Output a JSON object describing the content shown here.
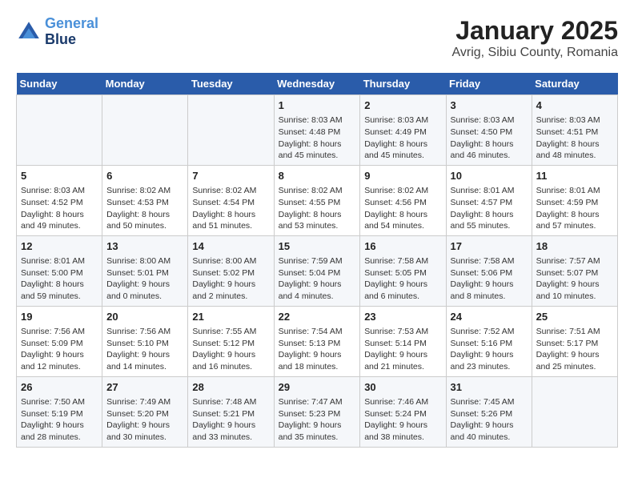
{
  "logo": {
    "line1": "General",
    "line2": "Blue"
  },
  "title": "January 2025",
  "subtitle": "Avrig, Sibiu County, Romania",
  "days_of_week": [
    "Sunday",
    "Monday",
    "Tuesday",
    "Wednesday",
    "Thursday",
    "Friday",
    "Saturday"
  ],
  "weeks": [
    [
      {
        "day": "",
        "info": ""
      },
      {
        "day": "",
        "info": ""
      },
      {
        "day": "",
        "info": ""
      },
      {
        "day": "1",
        "info": "Sunrise: 8:03 AM\nSunset: 4:48 PM\nDaylight: 8 hours\nand 45 minutes."
      },
      {
        "day": "2",
        "info": "Sunrise: 8:03 AM\nSunset: 4:49 PM\nDaylight: 8 hours\nand 45 minutes."
      },
      {
        "day": "3",
        "info": "Sunrise: 8:03 AM\nSunset: 4:50 PM\nDaylight: 8 hours\nand 46 minutes."
      },
      {
        "day": "4",
        "info": "Sunrise: 8:03 AM\nSunset: 4:51 PM\nDaylight: 8 hours\nand 48 minutes."
      }
    ],
    [
      {
        "day": "5",
        "info": "Sunrise: 8:03 AM\nSunset: 4:52 PM\nDaylight: 8 hours\nand 49 minutes."
      },
      {
        "day": "6",
        "info": "Sunrise: 8:02 AM\nSunset: 4:53 PM\nDaylight: 8 hours\nand 50 minutes."
      },
      {
        "day": "7",
        "info": "Sunrise: 8:02 AM\nSunset: 4:54 PM\nDaylight: 8 hours\nand 51 minutes."
      },
      {
        "day": "8",
        "info": "Sunrise: 8:02 AM\nSunset: 4:55 PM\nDaylight: 8 hours\nand 53 minutes."
      },
      {
        "day": "9",
        "info": "Sunrise: 8:02 AM\nSunset: 4:56 PM\nDaylight: 8 hours\nand 54 minutes."
      },
      {
        "day": "10",
        "info": "Sunrise: 8:01 AM\nSunset: 4:57 PM\nDaylight: 8 hours\nand 55 minutes."
      },
      {
        "day": "11",
        "info": "Sunrise: 8:01 AM\nSunset: 4:59 PM\nDaylight: 8 hours\nand 57 minutes."
      }
    ],
    [
      {
        "day": "12",
        "info": "Sunrise: 8:01 AM\nSunset: 5:00 PM\nDaylight: 8 hours\nand 59 minutes."
      },
      {
        "day": "13",
        "info": "Sunrise: 8:00 AM\nSunset: 5:01 PM\nDaylight: 9 hours\nand 0 minutes."
      },
      {
        "day": "14",
        "info": "Sunrise: 8:00 AM\nSunset: 5:02 PM\nDaylight: 9 hours\nand 2 minutes."
      },
      {
        "day": "15",
        "info": "Sunrise: 7:59 AM\nSunset: 5:04 PM\nDaylight: 9 hours\nand 4 minutes."
      },
      {
        "day": "16",
        "info": "Sunrise: 7:58 AM\nSunset: 5:05 PM\nDaylight: 9 hours\nand 6 minutes."
      },
      {
        "day": "17",
        "info": "Sunrise: 7:58 AM\nSunset: 5:06 PM\nDaylight: 9 hours\nand 8 minutes."
      },
      {
        "day": "18",
        "info": "Sunrise: 7:57 AM\nSunset: 5:07 PM\nDaylight: 9 hours\nand 10 minutes."
      }
    ],
    [
      {
        "day": "19",
        "info": "Sunrise: 7:56 AM\nSunset: 5:09 PM\nDaylight: 9 hours\nand 12 minutes."
      },
      {
        "day": "20",
        "info": "Sunrise: 7:56 AM\nSunset: 5:10 PM\nDaylight: 9 hours\nand 14 minutes."
      },
      {
        "day": "21",
        "info": "Sunrise: 7:55 AM\nSunset: 5:12 PM\nDaylight: 9 hours\nand 16 minutes."
      },
      {
        "day": "22",
        "info": "Sunrise: 7:54 AM\nSunset: 5:13 PM\nDaylight: 9 hours\nand 18 minutes."
      },
      {
        "day": "23",
        "info": "Sunrise: 7:53 AM\nSunset: 5:14 PM\nDaylight: 9 hours\nand 21 minutes."
      },
      {
        "day": "24",
        "info": "Sunrise: 7:52 AM\nSunset: 5:16 PM\nDaylight: 9 hours\nand 23 minutes."
      },
      {
        "day": "25",
        "info": "Sunrise: 7:51 AM\nSunset: 5:17 PM\nDaylight: 9 hours\nand 25 minutes."
      }
    ],
    [
      {
        "day": "26",
        "info": "Sunrise: 7:50 AM\nSunset: 5:19 PM\nDaylight: 9 hours\nand 28 minutes."
      },
      {
        "day": "27",
        "info": "Sunrise: 7:49 AM\nSunset: 5:20 PM\nDaylight: 9 hours\nand 30 minutes."
      },
      {
        "day": "28",
        "info": "Sunrise: 7:48 AM\nSunset: 5:21 PM\nDaylight: 9 hours\nand 33 minutes."
      },
      {
        "day": "29",
        "info": "Sunrise: 7:47 AM\nSunset: 5:23 PM\nDaylight: 9 hours\nand 35 minutes."
      },
      {
        "day": "30",
        "info": "Sunrise: 7:46 AM\nSunset: 5:24 PM\nDaylight: 9 hours\nand 38 minutes."
      },
      {
        "day": "31",
        "info": "Sunrise: 7:45 AM\nSunset: 5:26 PM\nDaylight: 9 hours\nand 40 minutes."
      },
      {
        "day": "",
        "info": ""
      }
    ]
  ]
}
